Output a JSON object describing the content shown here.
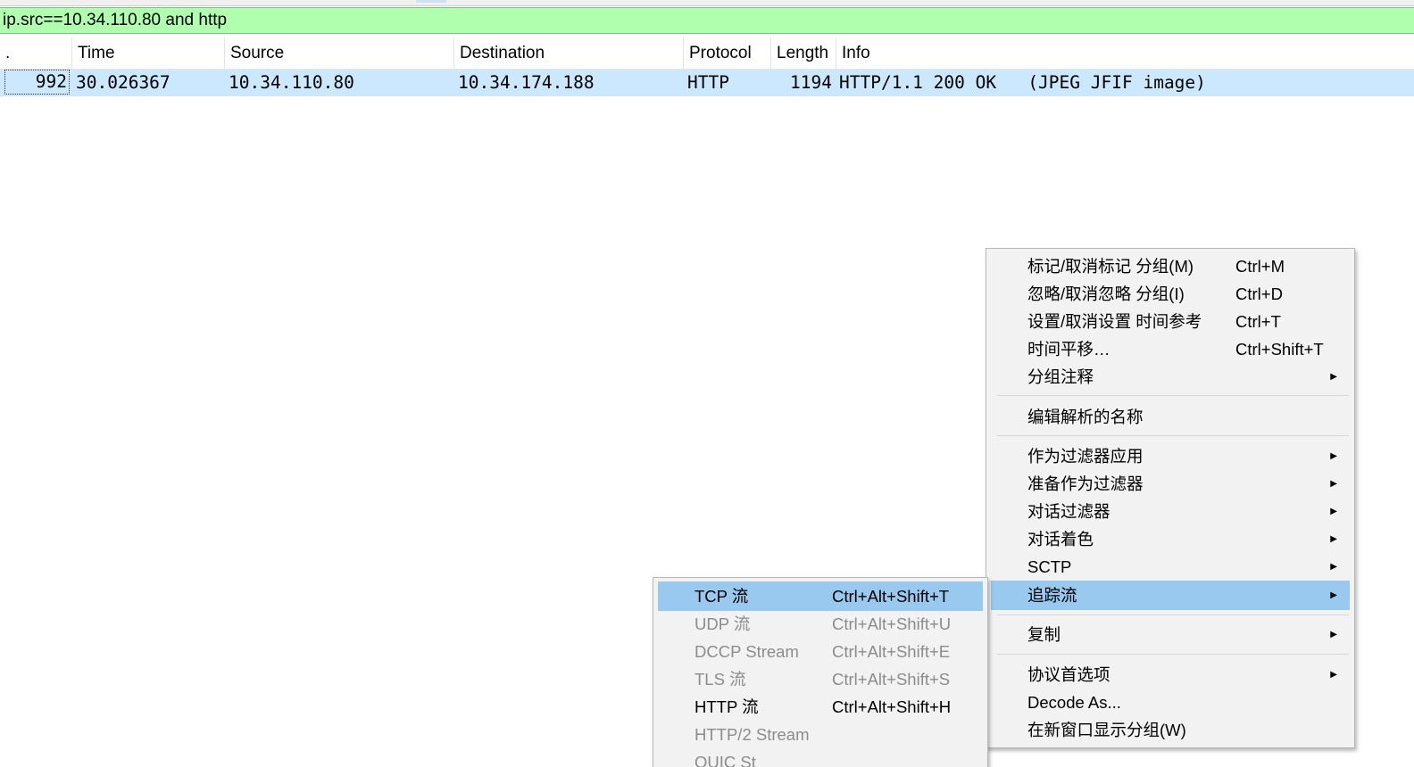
{
  "filter": {
    "expression": "ip.src==10.34.110.80 and http"
  },
  "columns": {
    "no": ".",
    "time": "Time",
    "source": "Source",
    "destination": "Destination",
    "protocol": "Protocol",
    "length": "Length",
    "info": "Info"
  },
  "packet": {
    "no": "992",
    "time": "30.026367",
    "source": "10.34.110.80",
    "destination": "10.34.174.188",
    "protocol": "HTTP",
    "length": "1194",
    "info": "HTTP/1.1 200 OK   (JPEG JFIF image)"
  },
  "context_menu": {
    "items": [
      {
        "label": "标记/取消标记 分组(M)",
        "shortcut": "Ctrl+M"
      },
      {
        "label": "忽略/取消忽略 分组(I)",
        "shortcut": "Ctrl+D"
      },
      {
        "label": "设置/取消设置 时间参考",
        "shortcut": "Ctrl+T"
      },
      {
        "label": "时间平移…",
        "shortcut": "Ctrl+Shift+T"
      },
      {
        "label": "分组注释",
        "shortcut": ""
      },
      {
        "label": "编辑解析的名称",
        "shortcut": ""
      },
      {
        "label": "作为过滤器应用",
        "shortcut": ""
      },
      {
        "label": "准备作为过滤器",
        "shortcut": ""
      },
      {
        "label": "对话过滤器",
        "shortcut": ""
      },
      {
        "label": "对话着色",
        "shortcut": ""
      },
      {
        "label": "SCTP",
        "shortcut": ""
      },
      {
        "label": "追踪流",
        "shortcut": ""
      },
      {
        "label": "复制",
        "shortcut": ""
      },
      {
        "label": "协议首选项",
        "shortcut": ""
      },
      {
        "label": "Decode As...",
        "shortcut": ""
      },
      {
        "label": "在新窗口显示分组(W)",
        "shortcut": ""
      }
    ]
  },
  "follow_submenu": {
    "items": [
      {
        "label": "TCP 流",
        "shortcut": "Ctrl+Alt+Shift+T"
      },
      {
        "label": "UDP 流",
        "shortcut": "Ctrl+Alt+Shift+U"
      },
      {
        "label": "DCCP Stream",
        "shortcut": "Ctrl+Alt+Shift+E"
      },
      {
        "label": "TLS 流",
        "shortcut": "Ctrl+Alt+Shift+S"
      },
      {
        "label": "HTTP 流",
        "shortcut": "Ctrl+Alt+Shift+H"
      },
      {
        "label": "HTTP/2 Stream",
        "shortcut": ""
      },
      {
        "label": "QUIC St",
        "shortcut": ""
      }
    ]
  },
  "colors": {
    "filter_valid_bg": "#afffaf",
    "selected_row_bg": "#cce8ff",
    "menu_highlight": "#99c9ef",
    "disabled_text": "#8c8c8c"
  }
}
